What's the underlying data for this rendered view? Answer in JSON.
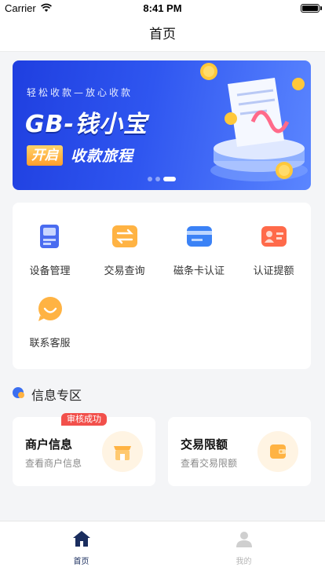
{
  "status_bar": {
    "carrier": "Carrier",
    "time": "8:41 PM"
  },
  "nav": {
    "title": "首页"
  },
  "banner": {
    "slogan": "轻松收款—放心收款",
    "brand": "GB-钱小宝",
    "cta_chip": "开启",
    "cta_text": "收款旅程",
    "slides": 3,
    "active_slide": 3
  },
  "menu": {
    "items": [
      {
        "label": "设备管理",
        "icon": "device-icon"
      },
      {
        "label": "交易查询",
        "icon": "exchange-icon"
      },
      {
        "label": "磁条卡认证",
        "icon": "card-icon"
      },
      {
        "label": "认证提额",
        "icon": "id-card-icon"
      },
      {
        "label": "联系客服",
        "icon": "chat-icon"
      }
    ]
  },
  "section": {
    "title": "信息专区"
  },
  "info_cards": [
    {
      "title": "商户信息",
      "subtitle": "查看商户信息",
      "badge": "审核成功",
      "icon": "store-icon"
    },
    {
      "title": "交易限额",
      "subtitle": "查看交易限额",
      "icon": "wallet-icon"
    }
  ],
  "tabs": [
    {
      "label": "首页",
      "icon": "home-icon",
      "active": true
    },
    {
      "label": "我的",
      "icon": "user-icon",
      "active": false
    }
  ],
  "colors": {
    "accent": "#1a2d5e",
    "badge": "#f2504b",
    "banner": "#2f56f0"
  }
}
